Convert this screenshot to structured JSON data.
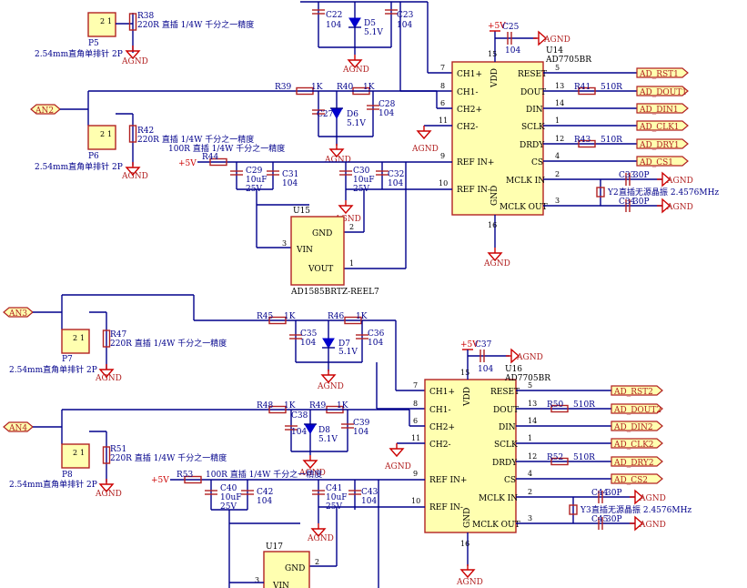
{
  "power_label": "+5V",
  "gnd_label": "AGND",
  "adc_part": "AD7705BR",
  "ldo_part": "AD1585BRTZ-REEL7",
  "ldo_pins": {
    "gnd": "GND",
    "vin": "VIN",
    "vout": "VOUT"
  },
  "adc_pins": {
    "vdd": "VDD",
    "ch1p": "CH1+",
    "ch1n": "CH1-",
    "ch2p": "CH2+",
    "ch2n": "CH2-",
    "refp": "REF IN+",
    "refn": "REF IN-",
    "gnd": "GND",
    "reset": "RESET",
    "dout": "DOUT",
    "din": "DIN",
    "sclk": "SCLK",
    "drdy": "DRDY",
    "cs": "CS",
    "mclkin": "MCLK IN",
    "mclkout": "MCLK OUT"
  },
  "pin_numbers": {
    "vdd": "15",
    "ch1p": "7",
    "ch1n": "8",
    "ch2p": "6",
    "ch2n": "11",
    "refp": "9",
    "refn": "10",
    "gnd": "16",
    "reset": "5",
    "dout": "13",
    "din": "14",
    "sclk": "1",
    "drdy": "12",
    "cs": "4",
    "mclkin": "2",
    "mclkout": "3",
    "ldo_vin": "3",
    "ldo_gnd": "2",
    "ldo_vout": "1"
  },
  "connector": {
    "desc": "2.54mm直角单排针 2P",
    "pin1": "1",
    "pin2": "2",
    "labels": {
      "P5": "P5",
      "P6": "P6",
      "P7": "P7",
      "P8": "P8"
    }
  },
  "resistor_note": "220R 直插 1/4W 千分之一精度",
  "resistor_note_100r": "100R 直插 1/4W 千分之一精度",
  "crystal_desc": "直插无源晶振 2.4576MHz",
  "value_labels": {
    "k1": "1K",
    "c104": "104",
    "zener": "5.1V",
    "r510": "510R",
    "p30": "30P",
    "c10uf": "10uF",
    "v25": "25V"
  },
  "analog_inputs": [
    "AN2",
    "AN3",
    "AN4"
  ],
  "block1": {
    "adc_ref": "U14",
    "ldo_ref": "U15",
    "cap_c22": "C22",
    "cap_c23": "C23",
    "zener_d5": "D5",
    "res_r38": "R38",
    "cap_c25": "C25",
    "res_r39": "R39",
    "res_r40": "R40",
    "cap_c27": "C27",
    "cap_c28": "C28",
    "zener_d6": "D6",
    "res_r42": "R42",
    "res_r44": "R44",
    "cap_c29": "C29",
    "cap_c31": "C31",
    "cap_c30": "C30",
    "cap_c32": "C32",
    "res_r41": "R41",
    "res_r43": "R43",
    "cap_c33": "C33",
    "cap_c34": "C34",
    "crystal": "Y2",
    "nets": [
      "AD_RST1",
      "AD_DOUT1",
      "AD_DIN1",
      "AD_CLK1",
      "AD_DRY1",
      "AD_CS1"
    ]
  },
  "block2": {
    "adc_ref": "U16",
    "ldo_ref": "U17",
    "res_r45": "R45",
    "res_r46": "R46",
    "cap_c35": "C35",
    "cap_c36": "C36",
    "zener_d7": "D7",
    "res_r47": "R47",
    "cap_c37": "C37",
    "res_r48": "R48",
    "res_r49": "R49",
    "cap_c38": "C38",
    "cap_c39": "C39",
    "zener_d8": "D8",
    "res_r51": "R51",
    "res_r53": "R53",
    "cap_c40": "C40",
    "cap_c42": "C42",
    "cap_c41": "C41",
    "cap_c43": "C43",
    "res_r50": "R50",
    "res_r52": "R52",
    "cap_c44": "C44",
    "cap_c45": "C45",
    "crystal": "Y3",
    "nets": [
      "AD_RST2",
      "AD_DOUT2",
      "AD_DIN2",
      "AD_CLK2",
      "AD_DRY2",
      "AD_CS2"
    ]
  }
}
